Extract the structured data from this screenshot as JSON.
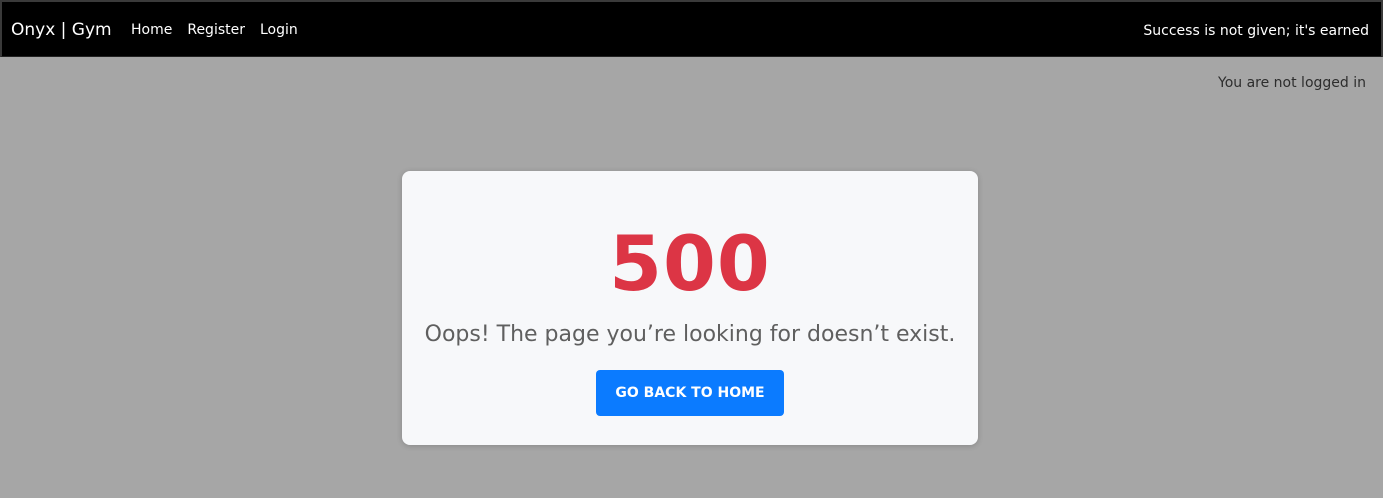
{
  "navbar": {
    "brand": "Onyx | Gym",
    "links": [
      "Home",
      "Register",
      "Login"
    ],
    "tagline": "Success is not given; it's earned"
  },
  "status": {
    "login_text": "You are not logged in"
  },
  "error": {
    "code": "500",
    "message": "Oops! The page you’re looking for doesn’t exist.",
    "button_label": "GO BACK TO HOME"
  },
  "colors": {
    "navbar_bg": "#000000",
    "page_bg": "#a6a6a6",
    "card_bg": "#f7f8fa",
    "error_red": "#dc3545",
    "button_blue": "#0b7bff"
  }
}
